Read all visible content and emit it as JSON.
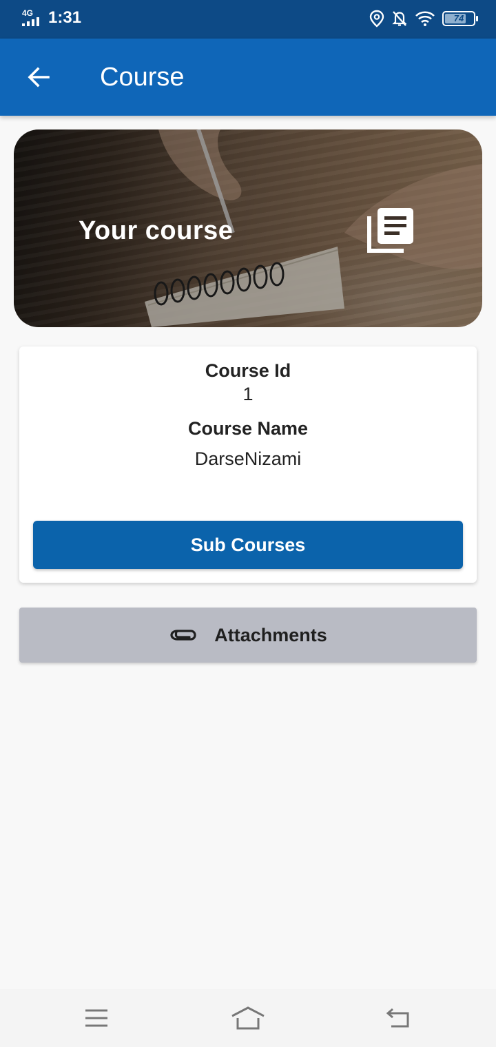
{
  "status_bar": {
    "network": "4G",
    "time": "1:31",
    "battery": "74"
  },
  "app_bar": {
    "title": "Course"
  },
  "hero": {
    "title": "Your course"
  },
  "course": {
    "id_label": "Course Id",
    "id_value": "1",
    "name_label": "Course Name",
    "name_value": "DarseNizami",
    "sub_courses_button": "Sub Courses"
  },
  "attachments": {
    "label": "Attachments"
  },
  "colors": {
    "status_bar": "#0d4a86",
    "app_bar": "#0f66b8",
    "primary_button": "#0b63ab",
    "secondary_button": "#b9bbc4",
    "background": "#f8f8f8"
  },
  "icons": [
    "back-arrow-icon",
    "library-books-icon",
    "paperclip-icon",
    "menu-icon",
    "home-icon",
    "back-nav-icon",
    "location-icon",
    "bell-off-icon",
    "wifi-icon",
    "battery-icon",
    "signal-icon"
  ]
}
